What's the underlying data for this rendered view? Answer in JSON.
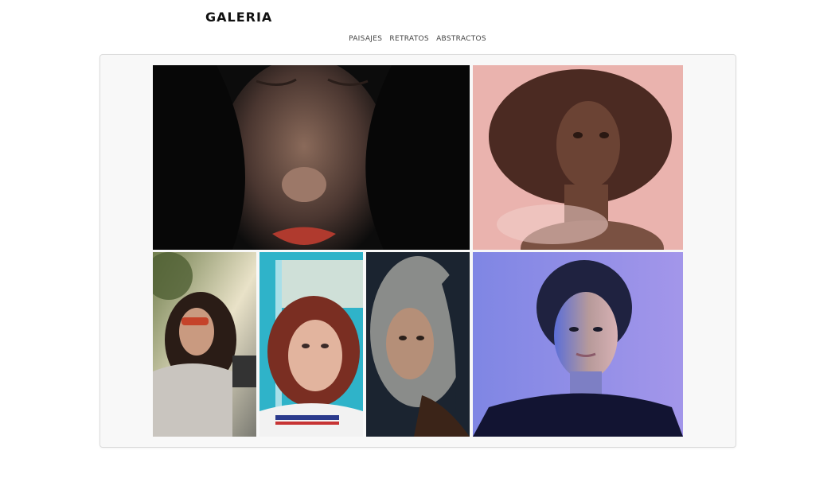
{
  "header": {
    "title": "GALERIA"
  },
  "nav": {
    "items": [
      {
        "label": "PAISAJES"
      },
      {
        "label": "RETRATOS"
      },
      {
        "label": "ABSTRACTOS"
      }
    ]
  },
  "gallery": {
    "photos": [
      {
        "subject": "portrait-freckles-red-lips",
        "background": "#0c0c0c"
      },
      {
        "subject": "portrait-curly-hair-pink-background",
        "background": "#e9b0ad"
      },
      {
        "subject": "portrait-sunglasses-outdoors",
        "background": "#a7b08c"
      },
      {
        "subject": "portrait-red-hair-teal-wall",
        "background": "#2fb3c9"
      },
      {
        "subject": "portrait-blonde-dark-background",
        "background": "#1b2430"
      },
      {
        "subject": "portrait-blue-purple-light",
        "background": "#8d8fe6"
      }
    ]
  }
}
